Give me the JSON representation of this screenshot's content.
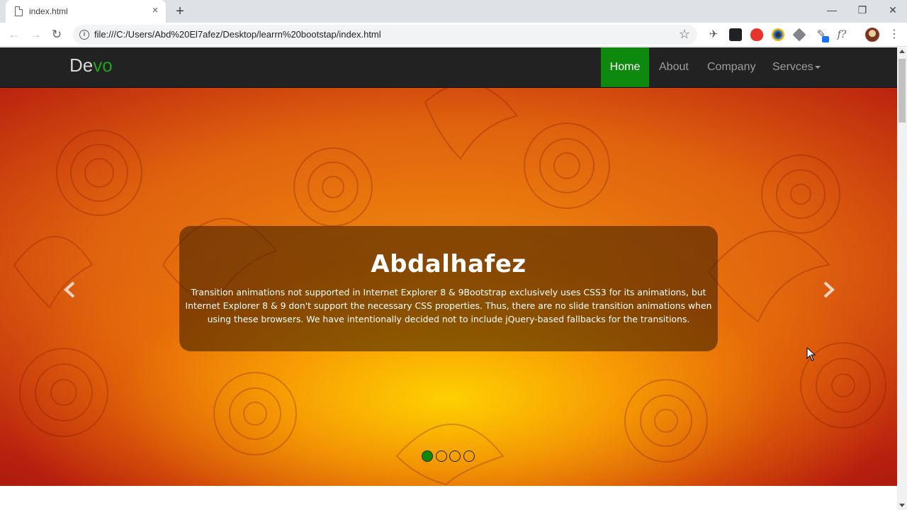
{
  "browser": {
    "tab_title": "index.html",
    "tab_close": "×",
    "new_tab": "+",
    "url": "file:///C:/Users/Abd%20El7afez/Desktop/learrn%20bootstap/index.html",
    "window_controls": {
      "minimize": "—",
      "restore": "❐",
      "close": "✕"
    },
    "nav": {
      "back": "←",
      "forward": "→",
      "reload": "↻"
    },
    "info_symbol": "i",
    "star": "☆",
    "extension_icons": [
      "extension-pin-icon",
      "incognito-extension-icon",
      "opera-extension-icon",
      "color-picker-extension-icon",
      "cube-extension-icon",
      "eyedropper-extension-icon",
      "function-extension-icon"
    ],
    "ext_glyphs": {
      "pin": "✈",
      "eyedropper": "✎",
      "function": "f?"
    },
    "menu": "⋮"
  },
  "navbar": {
    "brand_part1": "De",
    "brand_part2": "vo",
    "items": [
      {
        "label": "Home",
        "active": true
      },
      {
        "label": "About",
        "active": false
      },
      {
        "label": "Company",
        "active": false
      },
      {
        "label": "Servces",
        "active": false,
        "dropdown": true
      }
    ]
  },
  "carousel": {
    "caption_title": "Abdalhafez",
    "caption_text": "Transition animations not supported in Internet Explorer 8 & 9Bootstrap exclusively uses CSS3 for its animations, but Internet Explorer 8 & 9 don't support the necessary CSS properties. Thus, there are no slide transition animations when using these browsers. We have intentionally decided not to include jQuery-based fallbacks for the transitions.",
    "slide_count": 4,
    "active_slide": 1
  },
  "colors": {
    "navbar_bg": "#222222",
    "active_nav": "#0d8a0d",
    "brand_accent": "#1fa21f",
    "indicator_active": "#0b8a0b"
  }
}
